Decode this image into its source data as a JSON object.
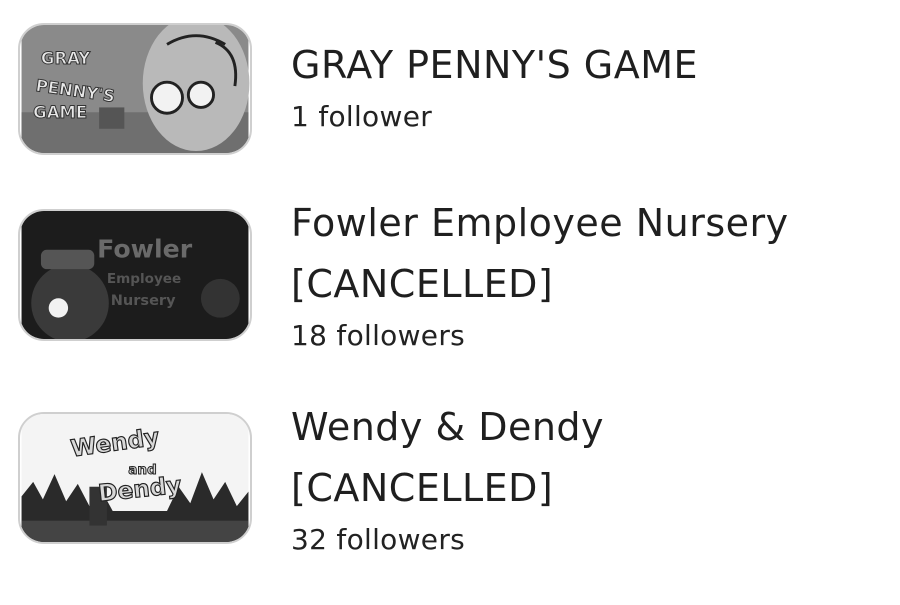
{
  "games": [
    {
      "title_line1": "GRAY PENNY'S GAME",
      "title_line2": "",
      "followers": "1 follower",
      "thumb_text": [
        "GRAY",
        "PENNY'S",
        "GAME"
      ]
    },
    {
      "title_line1": "Fowler Employee Nursery",
      "title_line2": "[CANCELLED]",
      "followers": "18 followers",
      "thumb_text": [
        "Fowler",
        "Employee",
        "Nursery"
      ]
    },
    {
      "title_line1": "Wendy & Dendy",
      "title_line2": "[CANCELLED]",
      "followers": "32 followers",
      "thumb_text": [
        "Wendy",
        "and",
        "Dendy"
      ]
    }
  ]
}
